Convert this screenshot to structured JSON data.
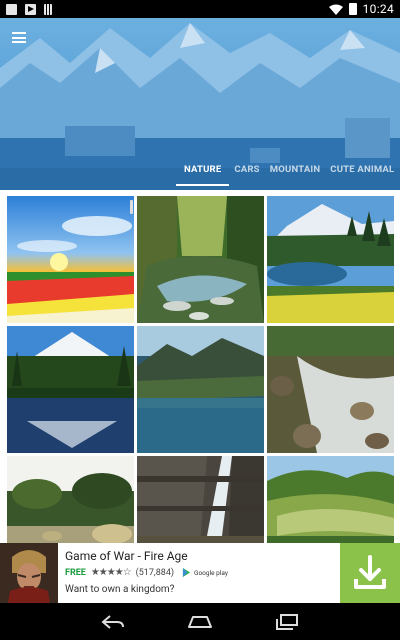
{
  "status_bar": {
    "time": "10:24",
    "icons": [
      "image-notification-icon",
      "youtube-notification-icon",
      "sd-card-icon",
      "wifi-icon",
      "battery-icon"
    ]
  },
  "header": {
    "menu_icon": "hamburger-menu-icon",
    "tabs": [
      {
        "label": "NATURE",
        "active": true
      },
      {
        "label": "CARS",
        "active": false
      },
      {
        "label": "MOUNTAIN",
        "active": false
      },
      {
        "label": "CUTE ANIMAL",
        "active": false
      }
    ]
  },
  "grid": {
    "category": "NATURE",
    "tiles": [
      "sunset-flower-field",
      "forest-stream",
      "snowy-peak-lake",
      "mountain-reflection-lake",
      "valley-river",
      "rocky-stream",
      "hay-bales-field",
      "canyon-waterfall",
      "green-hills-valley"
    ]
  },
  "ad": {
    "title": "Game of War - Fire Age",
    "price": "FREE",
    "stars": "★★★★☆",
    "rating_count": "(517,884)",
    "store_label": "Google play",
    "description": "Want to own a kingdom?",
    "accent_color": "#8bc34a"
  },
  "nav_bar": {
    "buttons": [
      "back-icon",
      "home-icon",
      "recents-icon"
    ]
  },
  "colors": {
    "header_blue": "#3b86c4",
    "status_bar": "#000000",
    "ad_download": "#8bc34a"
  }
}
